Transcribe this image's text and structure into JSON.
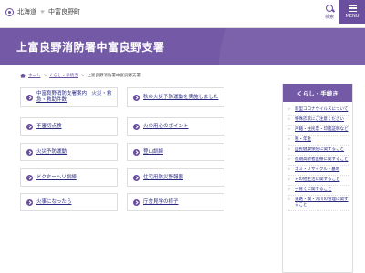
{
  "header": {
    "logo_pref": "北海道",
    "logo_sep": "✳",
    "logo_town": "中富良野町",
    "search_label": "検索",
    "menu_label": "MENU"
  },
  "hero": {
    "title": "上富良野消防署中富良野支署"
  },
  "breadcrumb": {
    "home": "ホーム",
    "level1": "くらし・手続き",
    "current": "上富良野消防署中富良野支署"
  },
  "cards": [
    {
      "label": "中富良野消防支署案内　火災・救急・救助件数"
    },
    {
      "label": "秋の火災予防運動を実施しました"
    },
    {
      "label": "不審切点検"
    },
    {
      "label": "火の用心のポイント"
    },
    {
      "label": "火災予防運動"
    },
    {
      "label": "登山訓練"
    },
    {
      "label": "ドクターヘリ訓練"
    },
    {
      "label": "住宅用防災警報器"
    },
    {
      "label": "火事になったら"
    },
    {
      "label": "庁舎見学の様子"
    }
  ],
  "sidebar": {
    "title": "くらし・手続き",
    "items": [
      {
        "label": "新型コロナウイルスについて"
      },
      {
        "label": "特殊詐欺にご注意ください"
      },
      {
        "label": "戸籍・住民票・印鑑証明など"
      },
      {
        "label": "税・年金"
      },
      {
        "label": "国民健康保険に関すること"
      },
      {
        "label": "後期高齢者医療に関すること"
      },
      {
        "label": "ゴミ・リサイクル・墓地"
      },
      {
        "label": "その他生活に関すること"
      },
      {
        "label": "子育てに関すること"
      },
      {
        "label": "道路・橋・河川の管理に関すること"
      }
    ]
  },
  "colors": {
    "accent": "#7359a6",
    "link": "#2a2a80"
  }
}
